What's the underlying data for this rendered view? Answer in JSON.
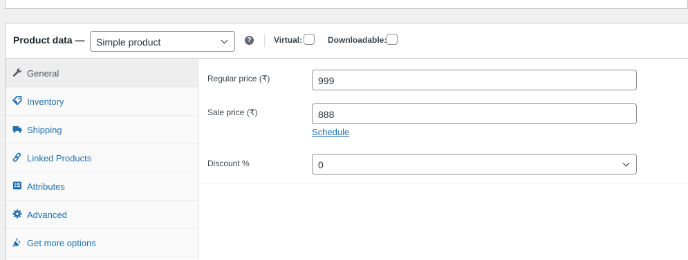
{
  "header": {
    "title": "Product data —",
    "product_type": "Simple product",
    "help_glyph": "?",
    "virtual_label": "Virtual:",
    "virtual_checked": false,
    "downloadable_label": "Downloadable:",
    "downloadable_checked": false
  },
  "tabs": [
    {
      "label": "General",
      "icon": "wrench-icon",
      "active": true
    },
    {
      "label": "Inventory",
      "icon": "tag-icon",
      "active": false
    },
    {
      "label": "Shipping",
      "icon": "truck-icon",
      "active": false
    },
    {
      "label": "Linked Products",
      "icon": "link-icon",
      "active": false
    },
    {
      "label": "Attributes",
      "icon": "list-icon",
      "active": false
    },
    {
      "label": "Advanced",
      "icon": "gear-icon",
      "active": false
    },
    {
      "label": "Get more options",
      "icon": "plugin-icon",
      "active": false
    }
  ],
  "general": {
    "regular_price_label": "Regular price (₹)",
    "regular_price_value": "999",
    "sale_price_label": "Sale price (₹)",
    "sale_price_value": "888",
    "schedule_link": "Schedule",
    "discount_label": "Discount %",
    "discount_value": "0"
  },
  "colors": {
    "link": "#2271b1",
    "icon": "#2271b1",
    "active_icon": "#50575e"
  }
}
